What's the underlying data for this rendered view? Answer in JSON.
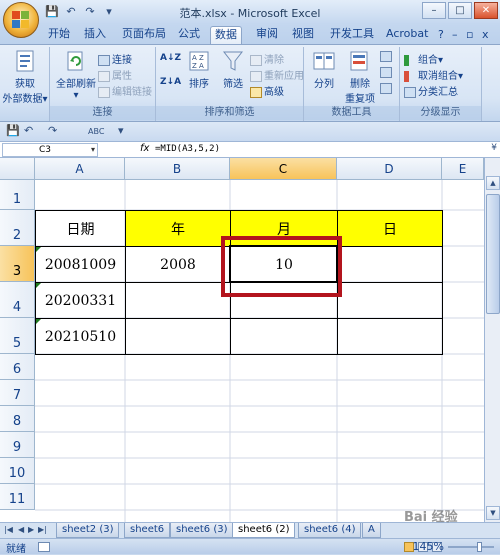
{
  "window": {
    "title": "范本.xlsx - Microsoft Excel",
    "minimize": "–",
    "maximize": "□",
    "close": "✕"
  },
  "qat_top": {
    "save": "💾",
    "undo": "↶",
    "redo": "↷",
    "more": "▾"
  },
  "tabs": [
    "开始",
    "插入",
    "页面布局",
    "公式",
    "数据",
    "审阅",
    "视图",
    "开发工具",
    "Acrobat"
  ],
  "active_tab": "数据",
  "tab_right": {
    "help": "?",
    "min": "–",
    "restore": "▫",
    "close": "x"
  },
  "ribbon": {
    "get_external": {
      "line1": "获取",
      "line2": "外部数据",
      "caret": "▾"
    },
    "connections": {
      "refresh_all": "全部刷新",
      "refresh_caret": "▾",
      "connections": "连接",
      "properties": "属性",
      "edit_links": "编辑链接",
      "label": "连接"
    },
    "sort_filter": {
      "az": "A↓Z",
      "za": "Z↓A",
      "sort": "排序",
      "filter": "筛选",
      "clear": "清除",
      "reapply": "重新应用",
      "advanced": "高级",
      "label": "排序和筛选"
    },
    "data_tools": {
      "split": "分列",
      "remove_dup_1": "删除",
      "remove_dup_2": "重复项",
      "label": "数据工具"
    },
    "outline": {
      "group": "组合",
      "ungroup": "取消组合",
      "subtotal": "分类汇总",
      "label": "分级显示",
      "caret": "▾"
    }
  },
  "quick_access": {
    "save": "💾",
    "undo": "↶",
    "redo": "↷",
    "spell": "ABC",
    "preview": "▾"
  },
  "formula_bar": {
    "name_box": "C3",
    "dropdown": "▾",
    "fx": "fx",
    "formula": "=MID(A3,5,2)",
    "expand": "¥"
  },
  "columns": [
    "A",
    "B",
    "C",
    "D",
    "E"
  ],
  "selected_column": "C",
  "rows": [
    "1",
    "2",
    "3",
    "4",
    "5",
    "6",
    "7",
    "8",
    "9",
    "10",
    "11"
  ],
  "selected_row": "3",
  "table": {
    "headers": [
      "日期",
      "年",
      "月",
      "日"
    ],
    "rows": [
      [
        "20081009",
        "2008",
        "10",
        ""
      ],
      [
        "20200331",
        "",
        "",
        ""
      ],
      [
        "20210510",
        "",
        "",
        ""
      ]
    ]
  },
  "header_fill": "#ffff00",
  "highlight_color": "#b3141d",
  "scrollbar": {
    "up": "▲",
    "down": "▼"
  },
  "sheet_nav": {
    "first": "|◀",
    "prev": "◀",
    "next": "▶",
    "last": "▶|"
  },
  "sheets": [
    "sheet2 (3)",
    "sheet6",
    "sheet6 (3)",
    "sheet6 (2)",
    "sheet6 (4)",
    "A"
  ],
  "active_sheet": "sheet6 (2)",
  "status": {
    "ready": "就绪",
    "zoom": "145%"
  },
  "watermark": "Bai 经验"
}
